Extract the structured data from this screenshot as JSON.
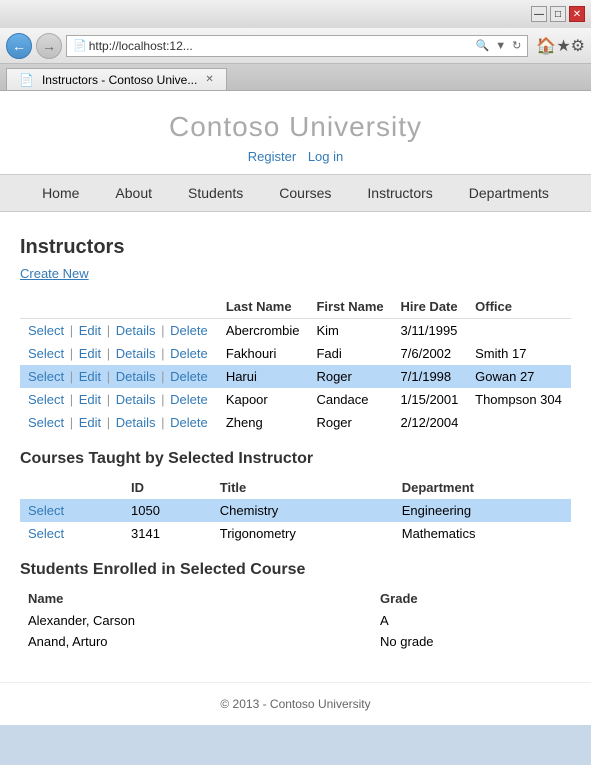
{
  "browser": {
    "address": "http://localhost:12...",
    "tab_title": "Instructors - Contoso Unive...",
    "title_bar_buttons": {
      "minimize": "—",
      "maximize": "□",
      "close": "✕"
    }
  },
  "header": {
    "site_title": "Contoso University",
    "auth": {
      "register": "Register",
      "login": "Log in"
    }
  },
  "nav": {
    "items": [
      {
        "label": "Home"
      },
      {
        "label": "About"
      },
      {
        "label": "Students"
      },
      {
        "label": "Courses"
      },
      {
        "label": "Instructors"
      },
      {
        "label": "Departments"
      }
    ]
  },
  "page": {
    "title": "Instructors",
    "create_new_label": "Create New"
  },
  "instructors_table": {
    "columns": [
      "",
      "Last Name",
      "First Name",
      "Hire Date",
      "Office"
    ],
    "rows": [
      {
        "last_name": "Abercrombie",
        "first_name": "Kim",
        "hire_date": "3/11/1995",
        "office": "",
        "selected": false
      },
      {
        "last_name": "Fakhouri",
        "first_name": "Fadi",
        "hire_date": "7/6/2002",
        "office": "Smith 17",
        "selected": false
      },
      {
        "last_name": "Harui",
        "first_name": "Roger",
        "hire_date": "7/1/1998",
        "office": "Gowan 27",
        "selected": true
      },
      {
        "last_name": "Kapoor",
        "first_name": "Candace",
        "hire_date": "1/15/2001",
        "office": "Thompson 304",
        "selected": false
      },
      {
        "last_name": "Zheng",
        "first_name": "Roger",
        "hire_date": "2/12/2004",
        "office": "",
        "selected": false
      }
    ],
    "action_select": "Select",
    "action_edit": "Edit",
    "action_details": "Details",
    "action_delete": "Delete"
  },
  "courses_section": {
    "title": "Courses Taught by Selected Instructor",
    "columns": [
      "",
      "ID",
      "Title",
      "Department"
    ],
    "rows": [
      {
        "id": "1050",
        "title": "Chemistry",
        "department": "Engineering",
        "selected": true
      },
      {
        "id": "3141",
        "title": "Trigonometry",
        "department": "Mathematics",
        "selected": false
      }
    ],
    "action_select": "Select"
  },
  "students_section": {
    "title": "Students Enrolled in Selected Course",
    "columns": [
      "Name",
      "Grade"
    ],
    "rows": [
      {
        "name": "Alexander, Carson",
        "grade": "A"
      },
      {
        "name": "Anand, Arturo",
        "grade": "No grade"
      }
    ]
  },
  "footer": {
    "text": "© 2013 - Contoso University"
  }
}
